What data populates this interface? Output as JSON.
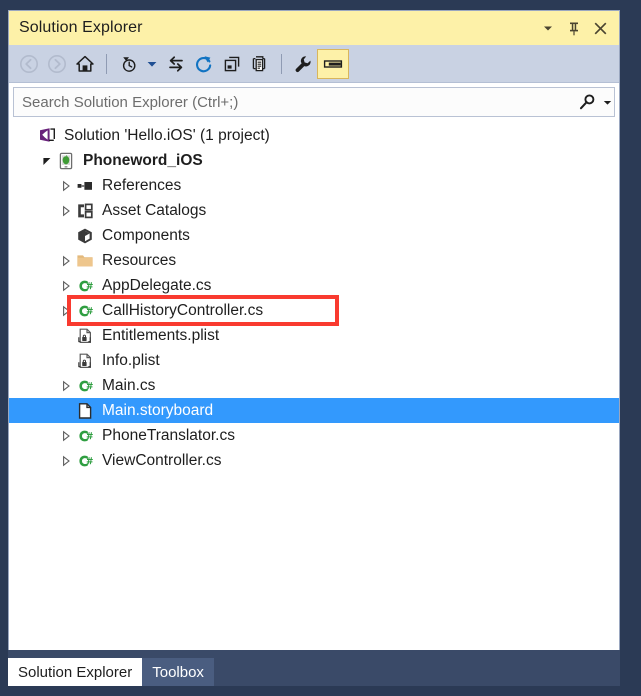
{
  "window": {
    "title": "Solution Explorer",
    "title_buttons": [
      {
        "name": "dropdown",
        "label": "▾"
      },
      {
        "name": "pin",
        "label": "pin"
      },
      {
        "name": "close",
        "label": "×"
      }
    ]
  },
  "toolbar": {
    "buttons": [
      {
        "name": "back",
        "icon": "back-arrow-icon",
        "enabled": false,
        "tooltip": "Back"
      },
      {
        "name": "forward",
        "icon": "forward-arrow-icon",
        "enabled": false,
        "tooltip": "Forward"
      },
      {
        "name": "home",
        "icon": "home-icon",
        "enabled": true,
        "tooltip": "Home"
      },
      {
        "name": "pending-changes",
        "icon": "clock-filter-icon",
        "enabled": true,
        "tooltip": "Pending Changes Filter"
      },
      {
        "name": "pending-changes-dropdown",
        "icon": "chevron-down-icon",
        "enabled": true,
        "tooltip": "Filter options"
      },
      {
        "name": "sync-with-active-document",
        "icon": "sync-arrows-icon",
        "enabled": true,
        "tooltip": "Sync with Active Document"
      },
      {
        "name": "refresh",
        "icon": "refresh-icon",
        "enabled": true,
        "tooltip": "Refresh"
      },
      {
        "name": "collapse-all",
        "icon": "collapse-all-icon",
        "enabled": true,
        "tooltip": "Collapse All"
      },
      {
        "name": "show-all-files",
        "icon": "show-all-files-icon",
        "enabled": true,
        "tooltip": "Show All Files"
      },
      {
        "name": "properties",
        "icon": "wrench-icon",
        "enabled": true,
        "tooltip": "Properties"
      },
      {
        "name": "preview-pane",
        "icon": "preview-pane-icon",
        "enabled": true,
        "pressed": true,
        "tooltip": "Preview Selected Items"
      }
    ]
  },
  "search": {
    "value": "",
    "placeholder": "Search Solution Explorer (Ctrl+;)",
    "icon": "search-icon",
    "dropdown_icon": "chevron-down-icon"
  },
  "tree": {
    "items": [
      {
        "label": "Solution 'Hello.iOS' (1 project)",
        "indent": 0,
        "expander": "none",
        "icon": "solution-icon",
        "bold": false,
        "selected": false
      },
      {
        "label": "Phoneword_iOS",
        "indent": 1,
        "expander": "expanded",
        "icon": "ios-project-icon",
        "bold": true,
        "selected": false
      },
      {
        "label": "References",
        "indent": 2,
        "expander": "collapsed",
        "icon": "references-icon",
        "bold": false,
        "selected": false
      },
      {
        "label": "Asset Catalogs",
        "indent": 2,
        "expander": "collapsed",
        "icon": "asset-catalog-icon",
        "bold": false,
        "selected": false
      },
      {
        "label": "Components",
        "indent": 2,
        "expander": "none",
        "icon": "components-icon",
        "bold": false,
        "selected": false
      },
      {
        "label": "Resources",
        "indent": 2,
        "expander": "collapsed",
        "icon": "folder-icon",
        "bold": false,
        "selected": false
      },
      {
        "label": "AppDelegate.cs",
        "indent": 2,
        "expander": "collapsed",
        "icon": "csharp-file-icon",
        "bold": false,
        "selected": false
      },
      {
        "label": "CallHistoryController.cs",
        "indent": 2,
        "expander": "collapsed",
        "icon": "csharp-file-icon",
        "bold": false,
        "selected": false,
        "highlighted": true
      },
      {
        "label": "Entitlements.plist",
        "indent": 2,
        "expander": "none",
        "icon": "plist-file-icon",
        "bold": false,
        "selected": false
      },
      {
        "label": "Info.plist",
        "indent": 2,
        "expander": "none",
        "icon": "plist-file-icon",
        "bold": false,
        "selected": false
      },
      {
        "label": "Main.cs",
        "indent": 2,
        "expander": "collapsed",
        "icon": "csharp-file-icon",
        "bold": false,
        "selected": false
      },
      {
        "label": "Main.storyboard",
        "indent": 2,
        "expander": "none",
        "icon": "document-file-icon",
        "bold": false,
        "selected": true
      },
      {
        "label": "PhoneTranslator.cs",
        "indent": 2,
        "expander": "collapsed",
        "icon": "csharp-file-icon",
        "bold": false,
        "selected": false
      },
      {
        "label": "ViewController.cs",
        "indent": 2,
        "expander": "collapsed",
        "icon": "csharp-file-icon",
        "bold": false,
        "selected": false
      }
    ]
  },
  "annotation": {
    "target_label": "CallHistoryController.cs",
    "color": "#f93a2f"
  },
  "tabs": [
    {
      "label": "Solution Explorer",
      "active": true
    },
    {
      "label": "Toolbox",
      "active": false
    }
  ],
  "colors": {
    "title_bar": "#fdf1a8",
    "toolbar": "#c9d2e3",
    "selection": "#3399fd",
    "annotation": "#f93a2f",
    "window_border": "#9aa7c0",
    "outer_background": "#2b3a55",
    "tab_strip": "#3a4a68",
    "inactive_tab": "#4a5d80"
  }
}
